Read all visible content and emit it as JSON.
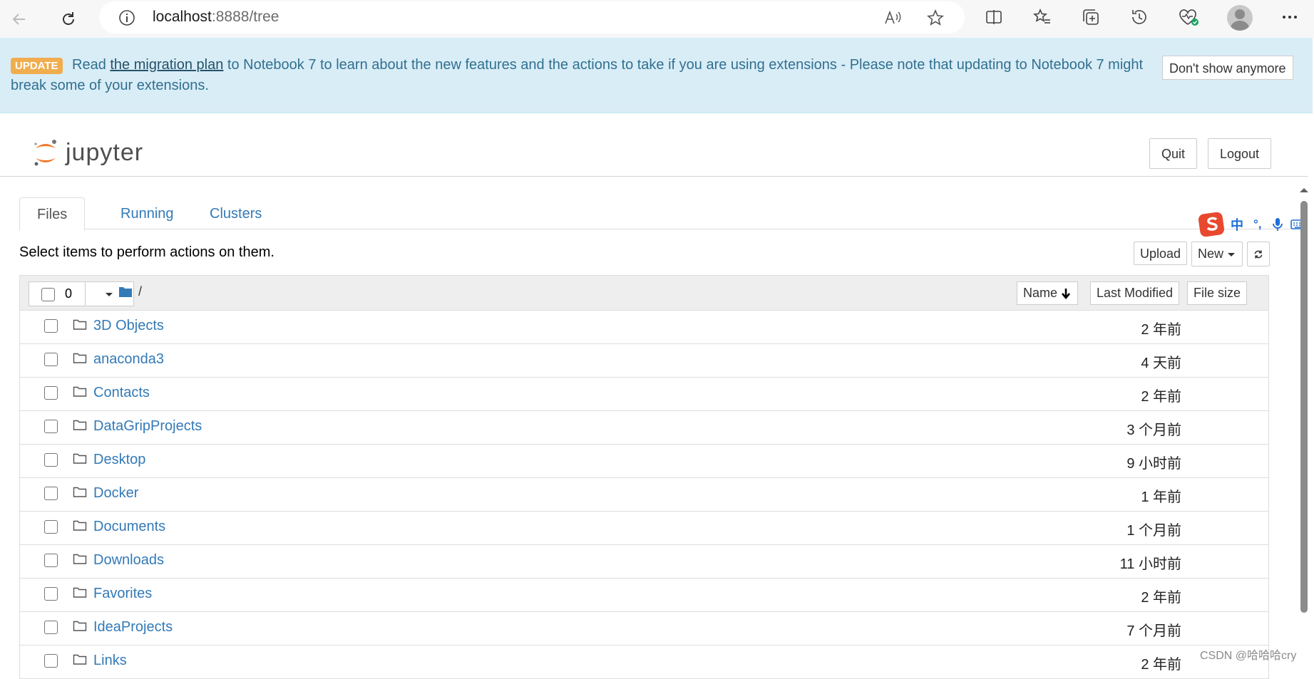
{
  "browser": {
    "url_host": "localhost",
    "url_path": ":8888/tree"
  },
  "banner": {
    "badge": "UPDATE",
    "text_before": "Read ",
    "link": "the migration plan",
    "text_after": " to Notebook 7 to learn about the new features and the actions to take if you are using extensions - Please note that updating to Notebook 7 might break some of your extensions.",
    "dismiss": "Don't show anymore"
  },
  "header": {
    "logo_text": "jupyter",
    "quit": "Quit",
    "logout": "Logout"
  },
  "tabs": [
    {
      "label": "Files"
    },
    {
      "label": "Running"
    },
    {
      "label": "Clusters"
    }
  ],
  "toolbar": {
    "hint": "Select items to perform actions on them.",
    "upload": "Upload",
    "new": "New"
  },
  "list": {
    "selected_count": "0",
    "breadcrumb": "/",
    "col_name": "Name",
    "col_modified": "Last Modified",
    "col_size": "File size",
    "rows": [
      {
        "name": "3D Objects",
        "modified": "2 年前"
      },
      {
        "name": "anaconda3",
        "modified": "4 天前"
      },
      {
        "name": "Contacts",
        "modified": "2 年前"
      },
      {
        "name": "DataGripProjects",
        "modified": "3 个月前"
      },
      {
        "name": "Desktop",
        "modified": "9 小时前"
      },
      {
        "name": "Docker",
        "modified": "1 年前"
      },
      {
        "name": "Documents",
        "modified": "1 个月前"
      },
      {
        "name": "Downloads",
        "modified": "11 小时前"
      },
      {
        "name": "Favorites",
        "modified": "2 年前"
      },
      {
        "name": "IdeaProjects",
        "modified": "7 个月前"
      },
      {
        "name": "Links",
        "modified": "2 年前"
      }
    ]
  },
  "ime": {
    "lang": "中",
    "punct": "°,"
  },
  "watermark": "CSDN @哈哈哈cry",
  "colors": {
    "link": "#337ab7",
    "banner_bg": "#d9edf7",
    "badge": "#f0ad4e",
    "ime_red": "#e8492e"
  }
}
